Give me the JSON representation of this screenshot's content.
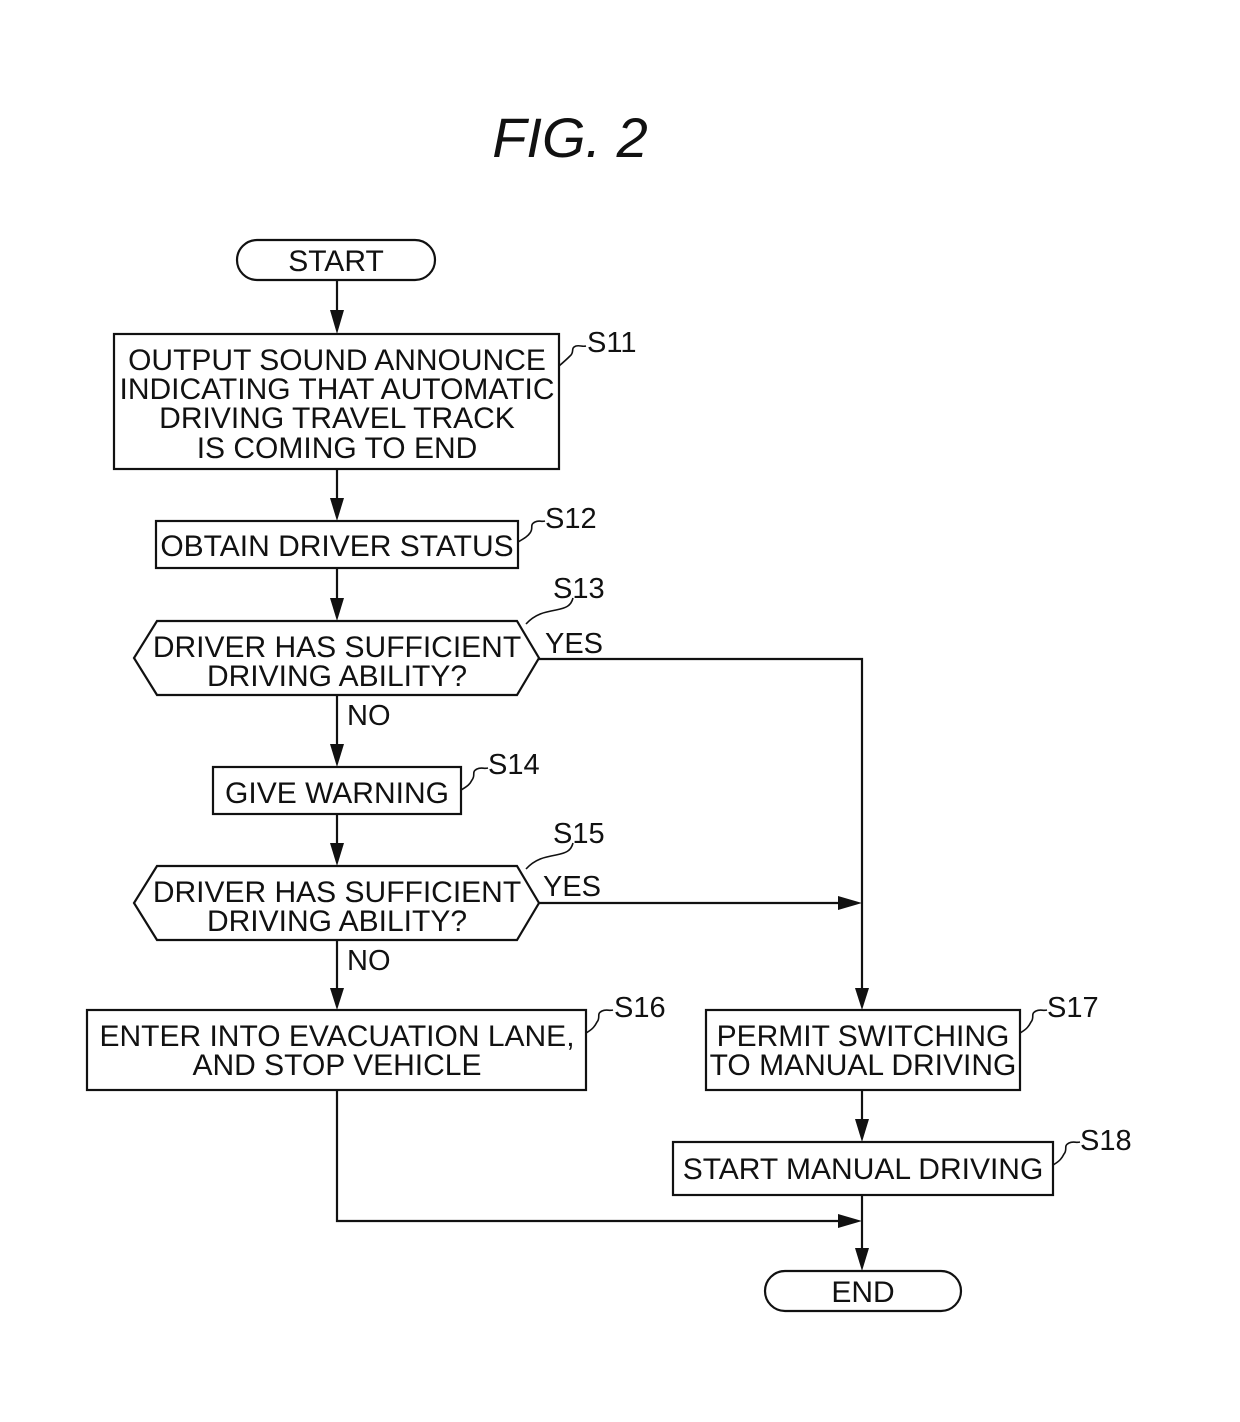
{
  "figure": {
    "title": "FIG. 2"
  },
  "nodes": {
    "start": {
      "label": "START"
    },
    "s11": {
      "step": "S11",
      "lines": [
        "OUTPUT SOUND ANNOUNCE",
        "INDICATING THAT AUTOMATIC",
        "DRIVING TRAVEL TRACK",
        "IS COMING TO END"
      ]
    },
    "s12": {
      "step": "S12",
      "lines": [
        "OBTAIN DRIVER STATUS"
      ]
    },
    "s13": {
      "step": "S13",
      "lines": [
        "DRIVER HAS SUFFICIENT",
        "DRIVING ABILITY?"
      ]
    },
    "s14": {
      "step": "S14",
      "lines": [
        "GIVE WARNING"
      ]
    },
    "s15": {
      "step": "S15",
      "lines": [
        "DRIVER HAS SUFFICIENT",
        "DRIVING ABILITY?"
      ]
    },
    "s16": {
      "step": "S16",
      "lines": [
        "ENTER INTO EVACUATION LANE,",
        "AND STOP VEHICLE"
      ]
    },
    "s17": {
      "step": "S17",
      "lines": [
        "PERMIT SWITCHING",
        "TO MANUAL DRIVING"
      ]
    },
    "s18": {
      "step": "S18",
      "lines": [
        "START MANUAL DRIVING"
      ]
    },
    "end": {
      "label": "END"
    }
  },
  "branches": {
    "s13_yes": "YES",
    "s13_no": "NO",
    "s15_yes": "YES",
    "s15_no": "NO"
  }
}
